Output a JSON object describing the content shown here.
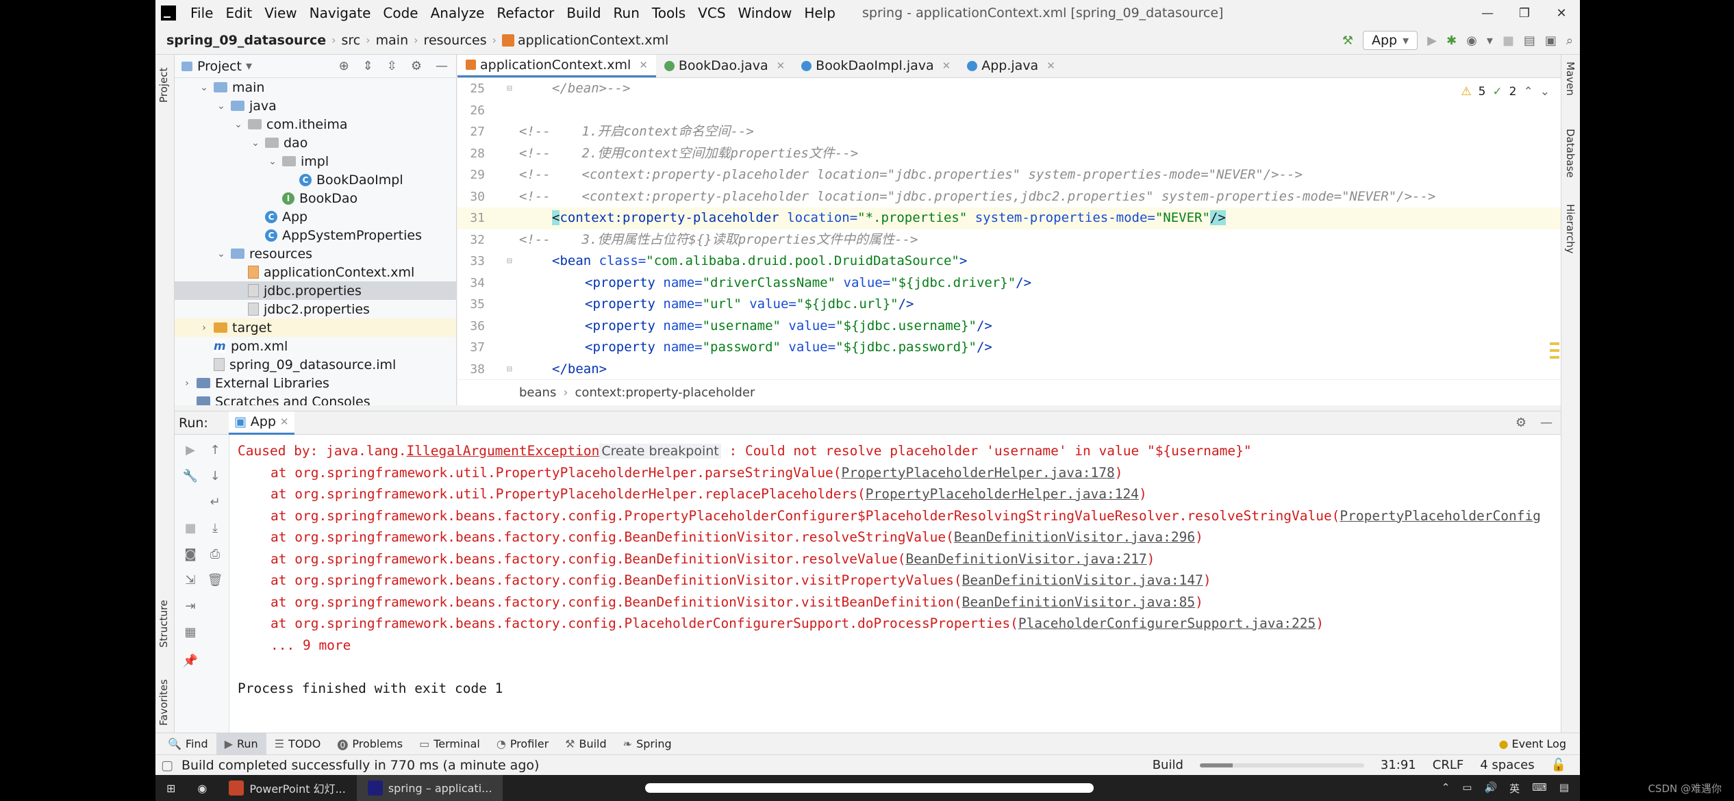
{
  "window": {
    "title": "spring - applicationContext.xml [spring_09_datasource]",
    "controls": [
      "—",
      "❐",
      "✕"
    ]
  },
  "menu": [
    "File",
    "Edit",
    "View",
    "Navigate",
    "Code",
    "Analyze",
    "Refactor",
    "Build",
    "Run",
    "Tools",
    "VCS",
    "Window",
    "Help"
  ],
  "breadcrumb": [
    "spring_09_datasource",
    "src",
    "main",
    "resources",
    "applicationContext.xml"
  ],
  "run_config": "App",
  "left_strip": [
    "Project",
    "Structure",
    "Favorites"
  ],
  "right_strip": [
    "Maven",
    "Database",
    "Hierarchy"
  ],
  "project": {
    "title": "Project",
    "tree": [
      {
        "label": "main",
        "level": 1,
        "icon": "folder",
        "open": true
      },
      {
        "label": "java",
        "level": 2,
        "icon": "folder",
        "open": true
      },
      {
        "label": "com.itheima",
        "level": 3,
        "icon": "package",
        "open": true
      },
      {
        "label": "dao",
        "level": 4,
        "icon": "package",
        "open": true
      },
      {
        "label": "impl",
        "level": 5,
        "icon": "package",
        "open": true
      },
      {
        "label": "BookDaoImpl",
        "level": 6,
        "icon": "class"
      },
      {
        "label": "BookDao",
        "level": 5,
        "icon": "interface"
      },
      {
        "label": "App",
        "level": 4,
        "icon": "class"
      },
      {
        "label": "AppSystemProperties",
        "level": 4,
        "icon": "class"
      },
      {
        "label": "resources",
        "level": 2,
        "icon": "folder",
        "open": true
      },
      {
        "label": "applicationContext.xml",
        "level": 3,
        "icon": "xml"
      },
      {
        "label": "jdbc.properties",
        "level": 3,
        "icon": "properties",
        "selected": true
      },
      {
        "label": "jdbc2.properties",
        "level": 3,
        "icon": "properties"
      },
      {
        "label": "target",
        "level": 1,
        "icon": "folder-orange",
        "closed": true,
        "highlight": true
      },
      {
        "label": "pom.xml",
        "level": 1,
        "icon": "maven"
      },
      {
        "label": "spring_09_datasource.iml",
        "level": 1,
        "icon": "file"
      },
      {
        "label": "External Libraries",
        "level": 0,
        "icon": "library",
        "closed": true
      },
      {
        "label": "Scratches and Consoles",
        "level": 0,
        "icon": "library"
      }
    ]
  },
  "editor": {
    "tabs": [
      {
        "label": "applicationContext.xml",
        "icon": "xml",
        "active": true
      },
      {
        "label": "BookDao.java",
        "icon": "interface"
      },
      {
        "label": "BookDaoImpl.java",
        "icon": "class"
      },
      {
        "label": "App.java",
        "icon": "class"
      }
    ],
    "inspections": {
      "warnings": "5",
      "weak": "2"
    },
    "lines": [
      {
        "n": "25",
        "indent": 1,
        "parts": [
          {
            "t": "</bean>-->",
            "c": "cmt"
          }
        ],
        "fold": true
      },
      {
        "n": "26",
        "indent": 0,
        "parts": []
      },
      {
        "n": "27",
        "indent": 0,
        "parts": [
          {
            "t": "<!--    1.开启context命名空间-->",
            "c": "cmt"
          }
        ]
      },
      {
        "n": "28",
        "indent": 0,
        "parts": [
          {
            "t": "<!--    2.使用context空间加载properties文件-->",
            "c": "cmt"
          }
        ]
      },
      {
        "n": "29",
        "indent": 0,
        "parts": [
          {
            "t": "<!--    <context:property-placeholder location=\"jdbc.properties\" system-properties-mode=\"NEVER\"/>-->",
            "c": "cmt"
          }
        ]
      },
      {
        "n": "30",
        "indent": 0,
        "parts": [
          {
            "t": "<!--    <context:property-placeholder location=\"jdbc.properties,jdbc2.properties\" system-properties-mode=\"NEVER\"/>-->",
            "c": "cmt"
          }
        ]
      },
      {
        "n": "31",
        "indent": 1,
        "current": true,
        "parts": [
          {
            "t": "<",
            "c": "brace-hl"
          },
          {
            "t": "context:property-placeholder ",
            "c": "tag"
          },
          {
            "t": "location=",
            "c": "attr"
          },
          {
            "t": "\"*.properties\"",
            "c": "str"
          },
          {
            "t": " system-properties-mode=",
            "c": "attr"
          },
          {
            "t": "\"NEVER\"",
            "c": "str"
          },
          {
            "t": "/>",
            "c": "brace-hl"
          }
        ]
      },
      {
        "n": "32",
        "indent": 0,
        "parts": [
          {
            "t": "<!--    3.使用属性占位符${}读取properties文件中的属性-->",
            "c": "cmt"
          }
        ]
      },
      {
        "n": "33",
        "indent": 1,
        "fold": true,
        "parts": [
          {
            "t": "<bean ",
            "c": "tag"
          },
          {
            "t": "class=",
            "c": "attr"
          },
          {
            "t": "\"com.alibaba.druid.pool.DruidDataSource\"",
            "c": "str"
          },
          {
            "t": ">",
            "c": "tag"
          }
        ]
      },
      {
        "n": "34",
        "indent": 2,
        "parts": [
          {
            "t": "<property ",
            "c": "tag"
          },
          {
            "t": "name=",
            "c": "attr"
          },
          {
            "t": "\"driverClassName\"",
            "c": "str"
          },
          {
            "t": " value=",
            "c": "attr"
          },
          {
            "t": "\"${jdbc.driver}\"",
            "c": "str"
          },
          {
            "t": "/>",
            "c": "tag"
          }
        ]
      },
      {
        "n": "35",
        "indent": 2,
        "parts": [
          {
            "t": "<property ",
            "c": "tag"
          },
          {
            "t": "name=",
            "c": "attr"
          },
          {
            "t": "\"url\"",
            "c": "str"
          },
          {
            "t": " value=",
            "c": "attr"
          },
          {
            "t": "\"${jdbc.url}\"",
            "c": "str"
          },
          {
            "t": "/>",
            "c": "tag"
          }
        ]
      },
      {
        "n": "36",
        "indent": 2,
        "parts": [
          {
            "t": "<property ",
            "c": "tag"
          },
          {
            "t": "name=",
            "c": "attr"
          },
          {
            "t": "\"username\"",
            "c": "str"
          },
          {
            "t": " value=",
            "c": "attr"
          },
          {
            "t": "\"${jdbc.username}\"",
            "c": "str"
          },
          {
            "t": "/>",
            "c": "tag"
          }
        ]
      },
      {
        "n": "37",
        "indent": 2,
        "parts": [
          {
            "t": "<property ",
            "c": "tag"
          },
          {
            "t": "name=",
            "c": "attr"
          },
          {
            "t": "\"password\"",
            "c": "str"
          },
          {
            "t": " value=",
            "c": "attr"
          },
          {
            "t": "\"${jdbc.password}\"",
            "c": "str"
          },
          {
            "t": "/>",
            "c": "tag"
          }
        ]
      },
      {
        "n": "38",
        "indent": 1,
        "fold": true,
        "parts": [
          {
            "t": "</bean>",
            "c": "tag"
          }
        ]
      }
    ],
    "code_breadcrumb": [
      "beans",
      "context:property-placeholder"
    ]
  },
  "run": {
    "label": "Run:",
    "tab": "App",
    "console": [
      {
        "kind": "cause",
        "prefix": "Caused by: java.lang.",
        "exception": "IllegalArgumentException",
        "hint": "Create breakpoint",
        "suffix": " : Could not resolve placeholder 'username' in value \"${username}\""
      },
      {
        "kind": "at",
        "text": "at org.springframework.util.PropertyPlaceholderHelper.parseStringValue(",
        "link": "PropertyPlaceholderHelper.java:178",
        "end": ")"
      },
      {
        "kind": "at",
        "text": "at org.springframework.util.PropertyPlaceholderHelper.replacePlaceholders(",
        "link": "PropertyPlaceholderHelper.java:124",
        "end": ")"
      },
      {
        "kind": "at",
        "text": "at org.springframework.beans.factory.config.PropertyPlaceholderConfigurer$PlaceholderResolvingStringValueResolver.resolveStringValue(",
        "link": "PropertyPlaceholderConfig",
        "end": ""
      },
      {
        "kind": "at",
        "text": "at org.springframework.beans.factory.config.BeanDefinitionVisitor.resolveStringValue(",
        "link": "BeanDefinitionVisitor.java:296",
        "end": ")"
      },
      {
        "kind": "at",
        "text": "at org.springframework.beans.factory.config.BeanDefinitionVisitor.resolveValue(",
        "link": "BeanDefinitionVisitor.java:217",
        "end": ")"
      },
      {
        "kind": "at",
        "text": "at org.springframework.beans.factory.config.BeanDefinitionVisitor.visitPropertyValues(",
        "link": "BeanDefinitionVisitor.java:147",
        "end": ")"
      },
      {
        "kind": "at",
        "text": "at org.springframework.beans.factory.config.BeanDefinitionVisitor.visitBeanDefinition(",
        "link": "BeanDefinitionVisitor.java:85",
        "end": ")"
      },
      {
        "kind": "at",
        "text": "at org.springframework.beans.factory.config.PlaceholderConfigurerSupport.doProcessProperties(",
        "link": "PlaceholderConfigurerSupport.java:225",
        "end": ")"
      },
      {
        "kind": "at",
        "text": "... 9 more",
        "link": "",
        "end": ""
      },
      {
        "kind": "blank",
        "text": ""
      },
      {
        "kind": "ok",
        "text": "Process finished with exit code 1"
      }
    ]
  },
  "bottom_tools": [
    {
      "label": "Find",
      "icon": "🔍"
    },
    {
      "label": "Run",
      "icon": "▶",
      "active": true
    },
    {
      "label": "TODO",
      "icon": "☰"
    },
    {
      "label": "Problems",
      "icon": "⓿"
    },
    {
      "label": "Terminal",
      "icon": "▭"
    },
    {
      "label": "Profiler",
      "icon": "◔"
    },
    {
      "label": "Build",
      "icon": "⚒"
    },
    {
      "label": "Spring",
      "icon": "❧"
    }
  ],
  "event_log": "Event Log",
  "status": {
    "message": "Build completed successfully in 770 ms (a minute ago)",
    "build_label": "Build",
    "build_progress": 0.2,
    "position": "31:91",
    "line_sep": "CRLF",
    "indent": "4 spaces"
  },
  "taskbar": {
    "tasks": [
      {
        "label": "PowerPoint 幻灯...",
        "color": "#c4452b"
      },
      {
        "label": "spring – applicati...",
        "color": "#1e1e7a",
        "active": true
      }
    ],
    "tray_lang": "英",
    "watermark": "CSDN @难遇你"
  },
  "colors": {
    "accent": "#4083c9",
    "error": "#d01b1b",
    "string": "#067d17",
    "tag": "#0033b3"
  }
}
